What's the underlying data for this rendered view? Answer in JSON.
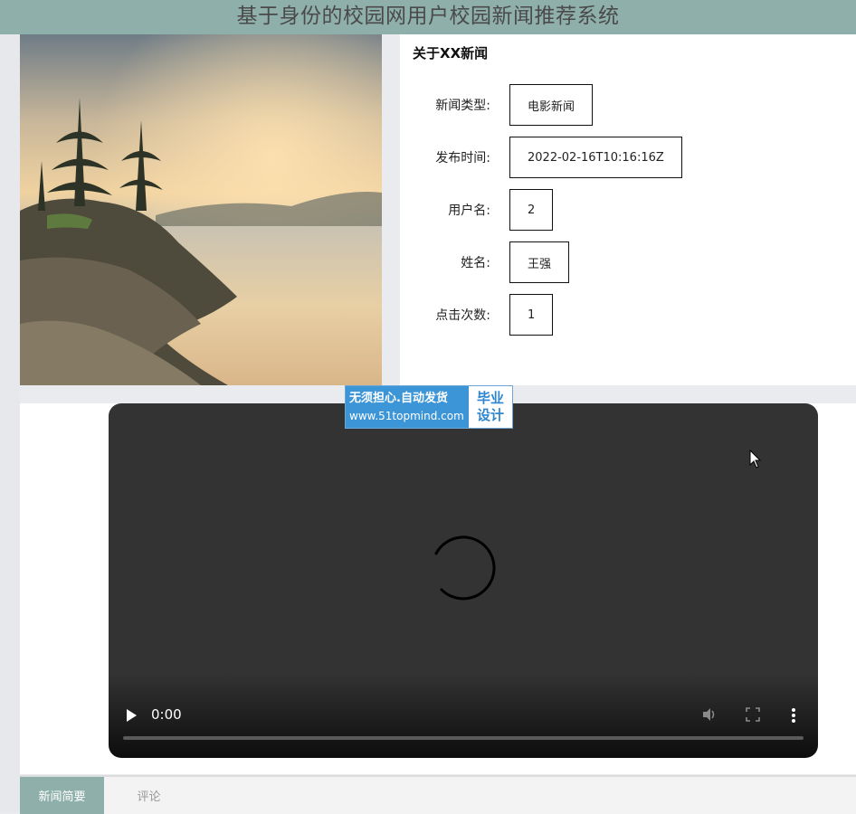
{
  "header": {
    "title": "基于身份的校园网用户校园新闻推荐系统"
  },
  "news": {
    "image_icon": "landscape-photo",
    "about_title": "关于XX新闻",
    "fields": [
      {
        "label": "新闻类型:",
        "value": "电影新闻"
      },
      {
        "label": "发布时间:",
        "value": "2022-02-16T10:16:16Z"
      },
      {
        "label": "用户名:",
        "value": "2"
      },
      {
        "label": "姓名:",
        "value": "王强"
      },
      {
        "label": "点击次数:",
        "value": "1"
      }
    ]
  },
  "video": {
    "time": "0:00",
    "icons": [
      "play-icon",
      "volume-icon",
      "fullscreen-icon",
      "more-vert-icon",
      "loading-spinner-icon"
    ]
  },
  "watermark": {
    "line1": "无须担心.自动发货",
    "line2": "www.51topmind.com",
    "right_line1": "毕业",
    "right_line2": "设计"
  },
  "tabs": [
    {
      "label": "新闻简要",
      "active": true
    },
    {
      "label": "评论",
      "active": false
    }
  ],
  "colors": {
    "header": "#8fb0aa",
    "tab_active": "#8fb0aa",
    "watermark": "#3b95d6"
  }
}
